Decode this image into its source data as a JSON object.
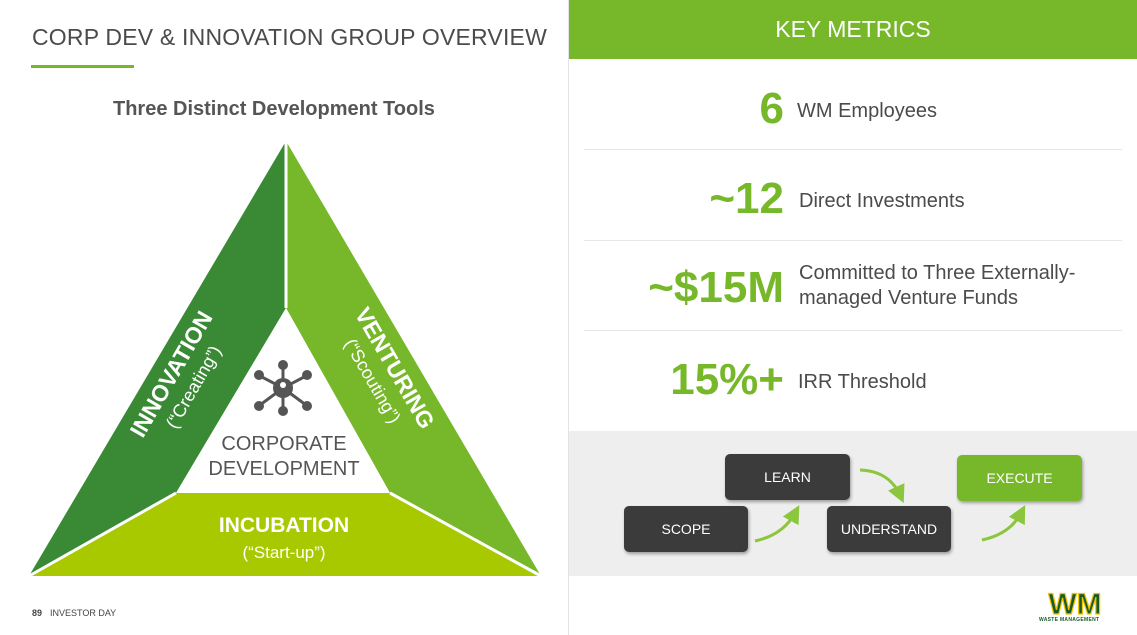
{
  "left": {
    "title": "CORP DEV & INNOVATION GROUP OVERVIEW",
    "subtitle": "Three Distinct Development Tools",
    "triangle": {
      "innovation": {
        "title": "INNOVATION",
        "sub": "(“Creating”)"
      },
      "venturing": {
        "title": "VENTURING",
        "sub": "(“Scouting”)"
      },
      "incubation": {
        "title": "INCUBATION",
        "sub": "(“Start-up”)"
      },
      "center_line1": "CORPORATE",
      "center_line2": "DEVELOPMENT",
      "center_icon": "network-hub-icon"
    }
  },
  "right": {
    "header": "KEY METRICS",
    "metrics": [
      {
        "value": "6",
        "label_line1": "WM Employees",
        "label_line2": ""
      },
      {
        "value": "~12",
        "label_line1": "Direct Investments",
        "label_line2": ""
      },
      {
        "value": "~$15M",
        "label_line1": "Committed to Three Externally-",
        "label_line2": "managed Venture Funds"
      },
      {
        "value": "15%+",
        "label_line1": "IRR Threshold",
        "label_line2": ""
      }
    ],
    "process": {
      "scope": "SCOPE",
      "learn": "LEARN",
      "understand": "UNDERSTAND",
      "execute": "EXECUTE"
    }
  },
  "footer": {
    "page_number": "89",
    "label": "INVESTOR DAY"
  },
  "logo": {
    "text": "WM",
    "sub": "WASTE MANAGEMENT"
  },
  "colors": {
    "brand_green": "#77b82a",
    "dark_green": "#3a8a35",
    "lime": "#a8c800",
    "dark_gray": "#3b3b3b"
  }
}
